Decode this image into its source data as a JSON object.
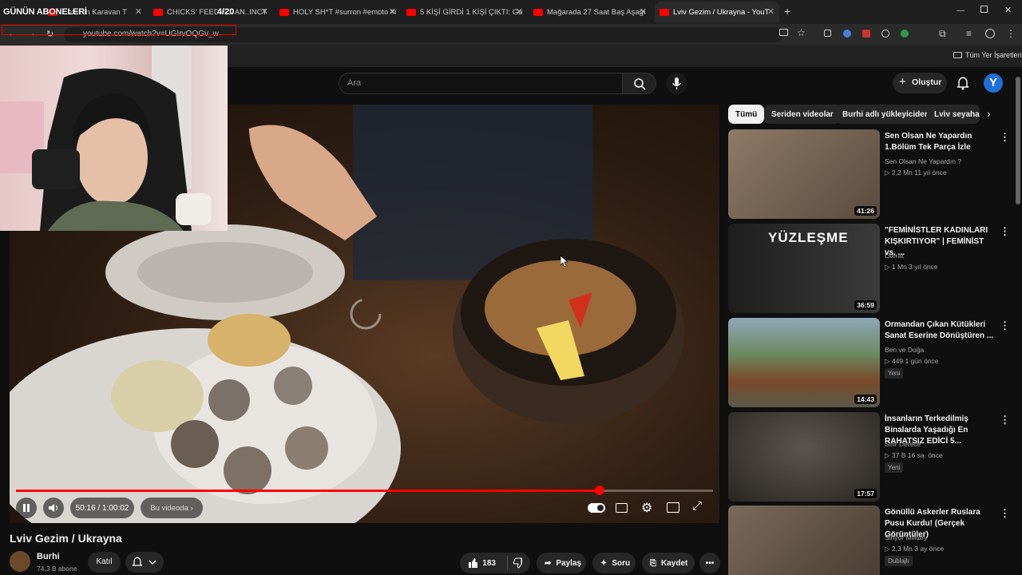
{
  "overlay": {
    "title": "GÜNÜN ABONELERİ",
    "count": "4/20"
  },
  "browser": {
    "tabs": [
      {
        "label": "...ete'nin Karavan T"
      },
      {
        "label": "CHICKS' FEEDING AN..INCT - Y"
      },
      {
        "label": "HOLY SH*T #surron #emoto #d"
      },
      {
        "label": "5 KİŞİ GİRDİ 1 KİŞİ ÇIKTI: Gollun"
      },
      {
        "label": "Mağarada 27 Saat Baş Aşağı Sa"
      },
      {
        "label": "Lviv Gezim / Ukrayna - YouT"
      }
    ],
    "url": "youtube.com/watch?v=UGIrvOQGv_w",
    "bookmarks_label": "Tüm Yer İşaretleri"
  },
  "header": {
    "search_placeholder": "Ara",
    "create_label": "Oluştur",
    "avatar_letter": "Y"
  },
  "player": {
    "time": "50:16 / 1:00:02",
    "chapter": "Bu videoda",
    "progress": 0.837
  },
  "video": {
    "title": "Lviv Gezim / Ukrayna",
    "channel": "Burhi",
    "subscribers": "74,3 B abone",
    "join_label": "Katıl",
    "likes": "183",
    "share_label": "Paylaş",
    "ask_label": "Soru",
    "save_label": "Kaydet"
  },
  "chips": [
    "Tümü",
    "Seriden videolar",
    "Burhi adlı yükleyiciden",
    "Lviv seyahat"
  ],
  "recommendations": [
    {
      "title": "Sen Olsan Ne Yapardın  1.Bölüm Tek Parça İzle",
      "channel": "Sen Olsan Ne Yapardın ?",
      "meta": "▷ 2,2 Mn  11 yıl önce",
      "badge": "",
      "duration": "41:26",
      "thumb_color": "#7a6a5a"
    },
    {
      "title": "\"FEMİNİSTLER KADINLARI KIŞKIRTIYOR\" | FEMİNİST vs. ...",
      "channel": "Literat",
      "meta": "▷ 1 Mn  3 yıl önce",
      "badge": "",
      "duration": "36:59",
      "thumb_color": "#2a2a2a",
      "thumb_text": "YÜZLEŞME"
    },
    {
      "title": "Ormandan Çıkan Kütükleri Sanat Eserine Dönüştüren ...",
      "channel": "Ben ve Doğa",
      "meta": "▷ 449  1 gün önce",
      "badge": "Yeni",
      "duration": "14:43",
      "thumb_color": "#5a6b4a"
    },
    {
      "title": "İnsanların Terkedilmiş Binalarda Yaşadığı En RAHATSIZ EDİCİ 5...",
      "channel": "Sıfır Derece",
      "meta": "▷ 37 B  16 sa. önce",
      "badge": "Yeni",
      "duration": "17:57",
      "thumb_color": "#3a3632"
    },
    {
      "title": "Gönüllü Askerler Ruslara Pusu Kurdu! (Gerçek Görüntüler)",
      "channel": "Sinyor Military",
      "meta": "▷ 2,3 Mn  3 ay önce",
      "badge": "Dublajlı",
      "duration": "",
      "thumb_color": "#6b5b4b"
    }
  ]
}
